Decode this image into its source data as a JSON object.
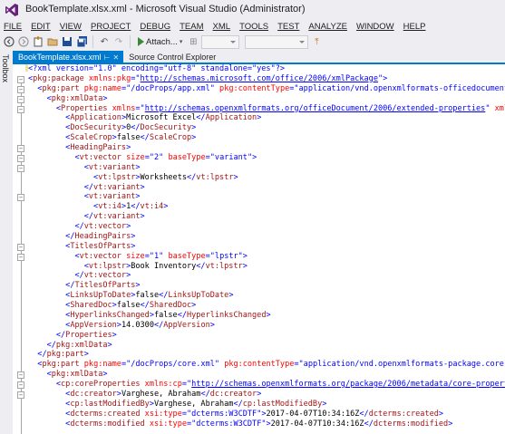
{
  "window": {
    "title": "BookTemplate.xlsx.xml - Microsoft Visual Studio (Administrator)"
  },
  "menu": [
    "FILE",
    "EDIT",
    "VIEW",
    "PROJECT",
    "DEBUG",
    "TEAM",
    "XML",
    "TOOLS",
    "TEST",
    "ANALYZE",
    "WINDOW",
    "HELP"
  ],
  "toolbar": {
    "attach_label": "Attach..."
  },
  "side": {
    "toolbox_label": "Toolbox"
  },
  "tabs": {
    "active": "BookTemplate.xlsx.xml",
    "inactive": "Source Control Explorer"
  },
  "editor": {
    "lines": [
      [
        [
          "pi",
          "<?xml version=\"1.0\" encoding=\"utf-8\" standalone=\"yes\"?>"
        ]
      ],
      [
        [
          "b",
          "<"
        ],
        [
          "e",
          "pkg:package"
        ],
        [
          "x",
          " "
        ],
        [
          "a",
          "xmlns:pkg"
        ],
        [
          "b",
          "=\""
        ],
        [
          "u",
          "http://schemas.microsoft.com/office/2006/xmlPackage"
        ],
        [
          "b",
          "\">"
        ]
      ],
      [
        [
          "x",
          "  "
        ],
        [
          "b",
          "<"
        ],
        [
          "e",
          "pkg:part"
        ],
        [
          "x",
          " "
        ],
        [
          "a",
          "pkg:name"
        ],
        [
          "b",
          "=\""
        ],
        [
          "v",
          "/docProps/app.xml"
        ],
        [
          "b",
          "\""
        ],
        [
          "x",
          " "
        ],
        [
          "a",
          "pkg:contentType"
        ],
        [
          "b",
          "=\""
        ],
        [
          "v",
          "application/vnd.openxmlformats-officedocument.extended"
        ]
      ],
      [
        [
          "x",
          "    "
        ],
        [
          "b",
          "<"
        ],
        [
          "e",
          "pkg:xmlData"
        ],
        [
          "b",
          ">"
        ]
      ],
      [
        [
          "x",
          "      "
        ],
        [
          "b",
          "<"
        ],
        [
          "e",
          "Properties"
        ],
        [
          "x",
          " "
        ],
        [
          "a",
          "xmlns"
        ],
        [
          "b",
          "=\""
        ],
        [
          "u",
          "http://schemas.openxmlformats.org/officeDocument/2006/extended-properties"
        ],
        [
          "b",
          "\""
        ],
        [
          "x",
          " "
        ],
        [
          "a",
          "xmlns:vt"
        ],
        [
          "b",
          "=\""
        ]
      ],
      [
        [
          "x",
          "        "
        ],
        [
          "b",
          "<"
        ],
        [
          "e",
          "Application"
        ],
        [
          "b",
          ">"
        ],
        [
          "x",
          "Microsoft Excel"
        ],
        [
          "b",
          "</"
        ],
        [
          "e",
          "Application"
        ],
        [
          "b",
          ">"
        ]
      ],
      [
        [
          "x",
          "        "
        ],
        [
          "b",
          "<"
        ],
        [
          "e",
          "DocSecurity"
        ],
        [
          "b",
          ">"
        ],
        [
          "x",
          "0"
        ],
        [
          "b",
          "</"
        ],
        [
          "e",
          "DocSecurity"
        ],
        [
          "b",
          ">"
        ]
      ],
      [
        [
          "x",
          "        "
        ],
        [
          "b",
          "<"
        ],
        [
          "e",
          "ScaleCrop"
        ],
        [
          "b",
          ">"
        ],
        [
          "x",
          "false"
        ],
        [
          "b",
          "</"
        ],
        [
          "e",
          "ScaleCrop"
        ],
        [
          "b",
          ">"
        ]
      ],
      [
        [
          "x",
          "        "
        ],
        [
          "b",
          "<"
        ],
        [
          "e",
          "HeadingPairs"
        ],
        [
          "b",
          ">"
        ]
      ],
      [
        [
          "x",
          "          "
        ],
        [
          "b",
          "<"
        ],
        [
          "e",
          "vt:vector"
        ],
        [
          "x",
          " "
        ],
        [
          "a",
          "size"
        ],
        [
          "b",
          "=\""
        ],
        [
          "v",
          "2"
        ],
        [
          "b",
          "\""
        ],
        [
          "x",
          " "
        ],
        [
          "a",
          "baseType"
        ],
        [
          "b",
          "=\""
        ],
        [
          "v",
          "variant"
        ],
        [
          "b",
          "\">"
        ]
      ],
      [
        [
          "x",
          "            "
        ],
        [
          "b",
          "<"
        ],
        [
          "e",
          "vt:variant"
        ],
        [
          "b",
          ">"
        ]
      ],
      [
        [
          "x",
          "              "
        ],
        [
          "b",
          "<"
        ],
        [
          "e",
          "vt:lpstr"
        ],
        [
          "b",
          ">"
        ],
        [
          "x",
          "Worksheets"
        ],
        [
          "b",
          "</"
        ],
        [
          "e",
          "vt:lpstr"
        ],
        [
          "b",
          ">"
        ]
      ],
      [
        [
          "x",
          "            "
        ],
        [
          "b",
          "</"
        ],
        [
          "e",
          "vt:variant"
        ],
        [
          "b",
          ">"
        ]
      ],
      [
        [
          "x",
          "            "
        ],
        [
          "b",
          "<"
        ],
        [
          "e",
          "vt:variant"
        ],
        [
          "b",
          ">"
        ]
      ],
      [
        [
          "x",
          "              "
        ],
        [
          "b",
          "<"
        ],
        [
          "e",
          "vt:i4"
        ],
        [
          "b",
          ">"
        ],
        [
          "x",
          "1"
        ],
        [
          "b",
          "</"
        ],
        [
          "e",
          "vt:i4"
        ],
        [
          "b",
          ">"
        ]
      ],
      [
        [
          "x",
          "            "
        ],
        [
          "b",
          "</"
        ],
        [
          "e",
          "vt:variant"
        ],
        [
          "b",
          ">"
        ]
      ],
      [
        [
          "x",
          "          "
        ],
        [
          "b",
          "</"
        ],
        [
          "e",
          "vt:vector"
        ],
        [
          "b",
          ">"
        ]
      ],
      [
        [
          "x",
          "        "
        ],
        [
          "b",
          "</"
        ],
        [
          "e",
          "HeadingPairs"
        ],
        [
          "b",
          ">"
        ]
      ],
      [
        [
          "x",
          "        "
        ],
        [
          "b",
          "<"
        ],
        [
          "e",
          "TitlesOfParts"
        ],
        [
          "b",
          ">"
        ]
      ],
      [
        [
          "x",
          "          "
        ],
        [
          "b",
          "<"
        ],
        [
          "e",
          "vt:vector"
        ],
        [
          "x",
          " "
        ],
        [
          "a",
          "size"
        ],
        [
          "b",
          "=\""
        ],
        [
          "v",
          "1"
        ],
        [
          "b",
          "\""
        ],
        [
          "x",
          " "
        ],
        [
          "a",
          "baseType"
        ],
        [
          "b",
          "=\""
        ],
        [
          "v",
          "lpstr"
        ],
        [
          "b",
          "\">"
        ]
      ],
      [
        [
          "x",
          "            "
        ],
        [
          "b",
          "<"
        ],
        [
          "e",
          "vt:lpstr"
        ],
        [
          "b",
          ">"
        ],
        [
          "x",
          "Book Inventory"
        ],
        [
          "b",
          "</"
        ],
        [
          "e",
          "vt:lpstr"
        ],
        [
          "b",
          ">"
        ]
      ],
      [
        [
          "x",
          "          "
        ],
        [
          "b",
          "</"
        ],
        [
          "e",
          "vt:vector"
        ],
        [
          "b",
          ">"
        ]
      ],
      [
        [
          "x",
          "        "
        ],
        [
          "b",
          "</"
        ],
        [
          "e",
          "TitlesOfParts"
        ],
        [
          "b",
          ">"
        ]
      ],
      [
        [
          "x",
          "        "
        ],
        [
          "b",
          "<"
        ],
        [
          "e",
          "LinksUpToDate"
        ],
        [
          "b",
          ">"
        ],
        [
          "x",
          "false"
        ],
        [
          "b",
          "</"
        ],
        [
          "e",
          "LinksUpToDate"
        ],
        [
          "b",
          ">"
        ]
      ],
      [
        [
          "x",
          "        "
        ],
        [
          "b",
          "<"
        ],
        [
          "e",
          "SharedDoc"
        ],
        [
          "b",
          ">"
        ],
        [
          "x",
          "false"
        ],
        [
          "b",
          "</"
        ],
        [
          "e",
          "SharedDoc"
        ],
        [
          "b",
          ">"
        ]
      ],
      [
        [
          "x",
          "        "
        ],
        [
          "b",
          "<"
        ],
        [
          "e",
          "HyperlinksChanged"
        ],
        [
          "b",
          ">"
        ],
        [
          "x",
          "false"
        ],
        [
          "b",
          "</"
        ],
        [
          "e",
          "HyperlinksChanged"
        ],
        [
          "b",
          ">"
        ]
      ],
      [
        [
          "x",
          "        "
        ],
        [
          "b",
          "<"
        ],
        [
          "e",
          "AppVersion"
        ],
        [
          "b",
          ">"
        ],
        [
          "x",
          "14.0300"
        ],
        [
          "b",
          "</"
        ],
        [
          "e",
          "AppVersion"
        ],
        [
          "b",
          ">"
        ]
      ],
      [
        [
          "x",
          "      "
        ],
        [
          "b",
          "</"
        ],
        [
          "e",
          "Properties"
        ],
        [
          "b",
          ">"
        ]
      ],
      [
        [
          "x",
          "    "
        ],
        [
          "b",
          "</"
        ],
        [
          "e",
          "pkg:xmlData"
        ],
        [
          "b",
          ">"
        ]
      ],
      [
        [
          "x",
          "  "
        ],
        [
          "b",
          "</"
        ],
        [
          "e",
          "pkg:part"
        ],
        [
          "b",
          ">"
        ]
      ],
      [
        [
          "x",
          "  "
        ],
        [
          "b",
          "<"
        ],
        [
          "e",
          "pkg:part"
        ],
        [
          "x",
          " "
        ],
        [
          "a",
          "pkg:name"
        ],
        [
          "b",
          "=\""
        ],
        [
          "v",
          "/docProps/core.xml"
        ],
        [
          "b",
          "\""
        ],
        [
          "x",
          " "
        ],
        [
          "a",
          "pkg:contentType"
        ],
        [
          "b",
          "=\""
        ],
        [
          "v",
          "application/vnd.openxmlformats-package.core-propert"
        ]
      ],
      [
        [
          "x",
          "    "
        ],
        [
          "b",
          "<"
        ],
        [
          "e",
          "pkg:xmlData"
        ],
        [
          "b",
          ">"
        ]
      ],
      [
        [
          "x",
          "      "
        ],
        [
          "b",
          "<"
        ],
        [
          "e",
          "cp:coreProperties"
        ],
        [
          "x",
          " "
        ],
        [
          "a",
          "xmlns:cp"
        ],
        [
          "b",
          "=\""
        ],
        [
          "u",
          "http://schemas.openxmlformats.org/package/2006/metadata/core-properties"
        ],
        [
          "b",
          "\""
        ],
        [
          "x",
          " "
        ],
        [
          "a",
          "xm"
        ]
      ],
      [
        [
          "x",
          "        "
        ],
        [
          "b",
          "<"
        ],
        [
          "e",
          "dc:creator"
        ],
        [
          "b",
          ">"
        ],
        [
          "x",
          "Varghese, Abraham"
        ],
        [
          "b",
          "</"
        ],
        [
          "e",
          "dc:creator"
        ],
        [
          "b",
          ">"
        ]
      ],
      [
        [
          "x",
          "        "
        ],
        [
          "b",
          "<"
        ],
        [
          "e",
          "cp:lastModifiedBy"
        ],
        [
          "b",
          ">"
        ],
        [
          "x",
          "Varghese, Abraham"
        ],
        [
          "b",
          "</"
        ],
        [
          "e",
          "cp:lastModifiedBy"
        ],
        [
          "b",
          ">"
        ]
      ],
      [
        [
          "x",
          "        "
        ],
        [
          "b",
          "<"
        ],
        [
          "e",
          "dcterms:created"
        ],
        [
          "x",
          " "
        ],
        [
          "a",
          "xsi:type"
        ],
        [
          "b",
          "=\""
        ],
        [
          "v",
          "dcterms:W3CDTF"
        ],
        [
          "b",
          "\">"
        ],
        [
          "x",
          "2017-04-07T10:34:16Z"
        ],
        [
          "b",
          "</"
        ],
        [
          "e",
          "dcterms:created"
        ],
        [
          "b",
          ">"
        ]
      ],
      [
        [
          "x",
          "        "
        ],
        [
          "b",
          "<"
        ],
        [
          "e",
          "dcterms:modified"
        ],
        [
          "x",
          " "
        ],
        [
          "a",
          "xsi:type"
        ],
        [
          "b",
          "=\""
        ],
        [
          "v",
          "dcterms:W3CDTF"
        ],
        [
          "b",
          "\">"
        ],
        [
          "x",
          "2017-04-07T10:34:16Z"
        ],
        [
          "b",
          "</"
        ],
        [
          "e",
          "dcterms:modified"
        ],
        [
          "b",
          ">"
        ]
      ]
    ]
  }
}
